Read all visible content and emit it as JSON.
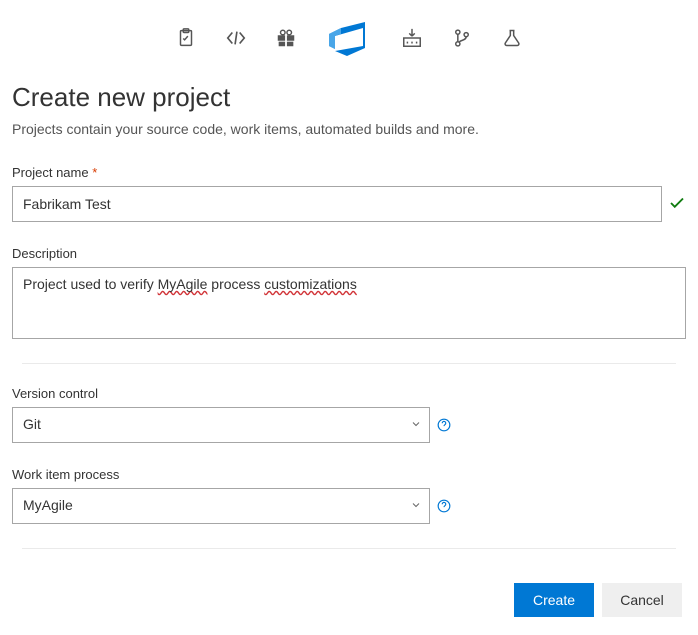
{
  "icons": [
    {
      "name": "clipboard-icon"
    },
    {
      "name": "code-icon"
    },
    {
      "name": "gift-icon"
    },
    {
      "name": "azure-devops-logo-icon"
    },
    {
      "name": "download-box-icon"
    },
    {
      "name": "branch-icon"
    },
    {
      "name": "flask-icon"
    }
  ],
  "header": {
    "title": "Create new project",
    "subtitle": "Projects contain your source code, work items, automated builds and more."
  },
  "form": {
    "project_name": {
      "label": "Project name",
      "required_mark": "*",
      "value": "Fabrikam Test"
    },
    "description": {
      "label": "Description",
      "value_pre": "Project used to verify ",
      "value_w1": "MyAgile",
      "value_mid": " process ",
      "value_w2": "customizations"
    },
    "version_control": {
      "label": "Version control",
      "value": "Git"
    },
    "work_item_process": {
      "label": "Work item process",
      "value": "MyAgile"
    }
  },
  "buttons": {
    "create": "Create",
    "cancel": "Cancel"
  }
}
